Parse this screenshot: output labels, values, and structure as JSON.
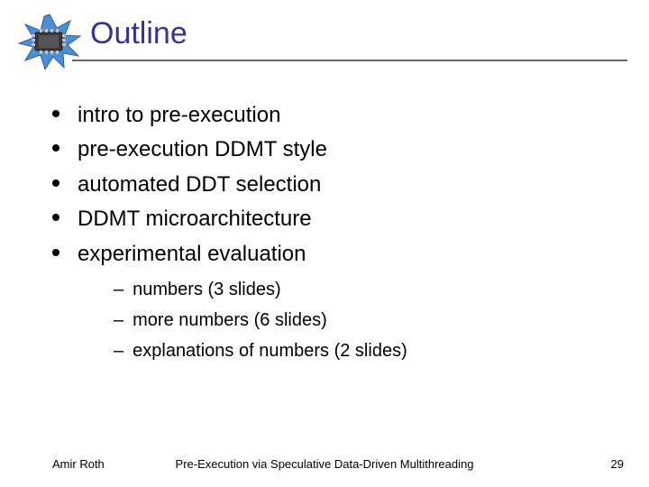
{
  "title": "Outline",
  "bullets": [
    {
      "text": "intro to pre-execution"
    },
    {
      "text": "pre-execution DDMT style"
    },
    {
      "text": "automated DDT selection"
    },
    {
      "text": "DDMT microarchitecture"
    },
    {
      "text": "experimental evaluation"
    }
  ],
  "sub_bullets": [
    {
      "text": "numbers (3 slides)"
    },
    {
      "text": "more numbers (6 slides)"
    },
    {
      "text": "explanations of numbers (2 slides)"
    }
  ],
  "footer": {
    "author": "Amir Roth",
    "center": "Pre-Execution via Speculative Data-Driven Multithreading",
    "page": "29"
  },
  "icon": "chip-starburst"
}
